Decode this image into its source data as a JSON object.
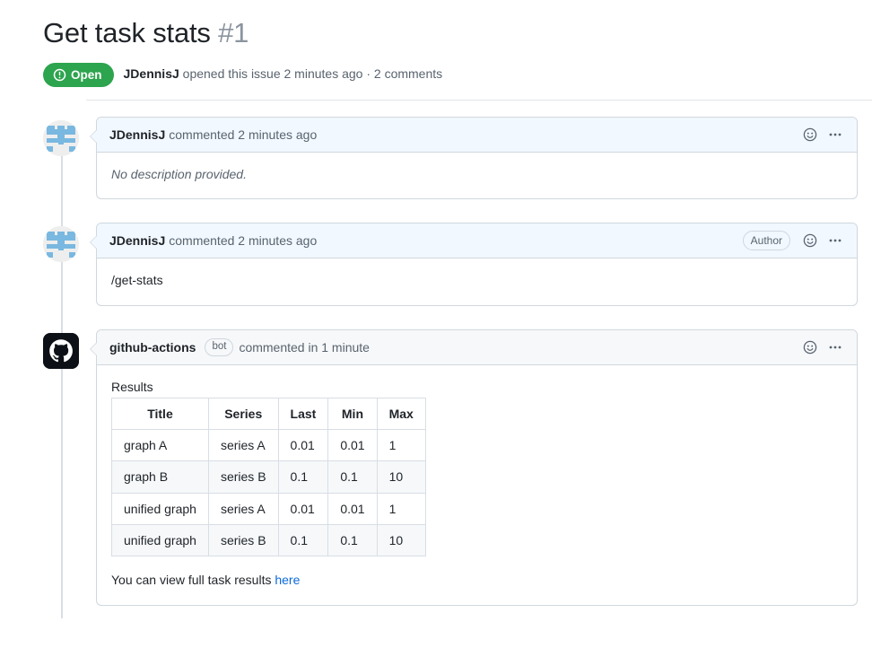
{
  "issue": {
    "title": "Get task stats",
    "number": "#1",
    "state_label": "Open",
    "state_color": "#2da44e",
    "meta_author": "JDennisJ",
    "meta_action": "opened this issue 2 minutes ago · 2 comments"
  },
  "comments": [
    {
      "author": "JDennisJ",
      "action": "commented 2 minutes ago",
      "avatar": "identicon-avatar",
      "badge": null,
      "body_text": "No description provided.",
      "body_style": "muted-italic"
    },
    {
      "author": "JDennisJ",
      "action": "commented 2 minutes ago",
      "avatar": "identicon-avatar",
      "badge": "Author",
      "body_text": "/get-stats",
      "body_style": "plain"
    },
    {
      "author": "github-actions",
      "action": "commented in 1 minute",
      "avatar": "github-logo-avatar",
      "badge": "bot",
      "results_label": "Results",
      "footer_prefix": "You can view full task results ",
      "footer_link": "here"
    }
  ],
  "results_table": {
    "columns": [
      "Title",
      "Series",
      "Last",
      "Min",
      "Max"
    ],
    "rows": [
      [
        "graph A",
        "series A",
        "0.01",
        "0.01",
        "1"
      ],
      [
        "graph B",
        "series B",
        "0.1",
        "0.1",
        "10"
      ],
      [
        "unified graph",
        "series A",
        "0.01",
        "0.01",
        "1"
      ],
      [
        "unified graph",
        "series B",
        "0.1",
        "0.1",
        "10"
      ]
    ]
  },
  "icons": {
    "reaction": "smiley-icon",
    "menu": "kebab-menu-icon",
    "state": "issue-opened-icon"
  },
  "colors": {
    "open_green": "#2da44e",
    "link_blue": "#0969da",
    "header_blue": "#f1f8ff",
    "header_gray": "#f6f8fa",
    "border": "#d0d7de"
  }
}
